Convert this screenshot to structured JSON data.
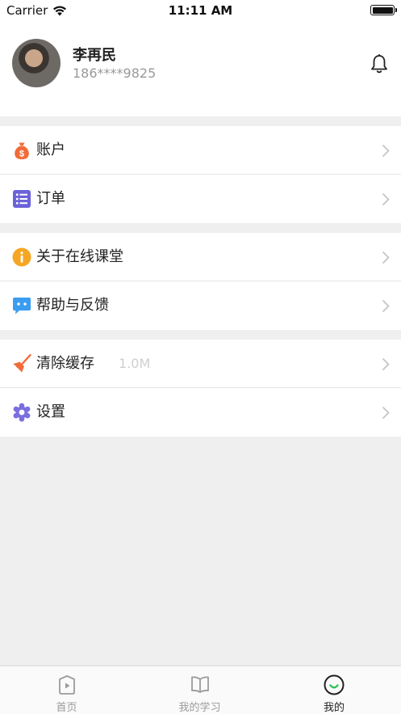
{
  "status_bar": {
    "carrier": "Carrier",
    "time": "11:11 AM"
  },
  "profile": {
    "name": "李再民",
    "phone": "186****9825"
  },
  "menu_groups": [
    {
      "items": [
        {
          "label": "账户",
          "icon": "money-bag-icon"
        },
        {
          "label": "订单",
          "icon": "list-icon"
        }
      ]
    },
    {
      "items": [
        {
          "label": "关于在线课堂",
          "icon": "info-icon"
        },
        {
          "label": "帮助与反馈",
          "icon": "chat-bubble-icon"
        }
      ]
    },
    {
      "items": [
        {
          "label": "清除缓存",
          "extra": "1.0M",
          "icon": "broom-icon"
        },
        {
          "label": "设置",
          "icon": "gear-icon"
        }
      ]
    }
  ],
  "tab_bar": {
    "tabs": [
      {
        "label": "首页",
        "icon": "play-icon",
        "active": false
      },
      {
        "label": "我的学习",
        "icon": "book-icon",
        "active": false
      },
      {
        "label": "我的",
        "icon": "smile-icon",
        "active": true
      }
    ]
  },
  "colors": {
    "accent_orange": "#f26b3a",
    "list_purple": "#6b63d9",
    "info_yellow": "#f5a623",
    "chat_blue": "#3a9df0",
    "gear_purple": "#7a6fe0",
    "active_green": "#2fbf5a"
  }
}
